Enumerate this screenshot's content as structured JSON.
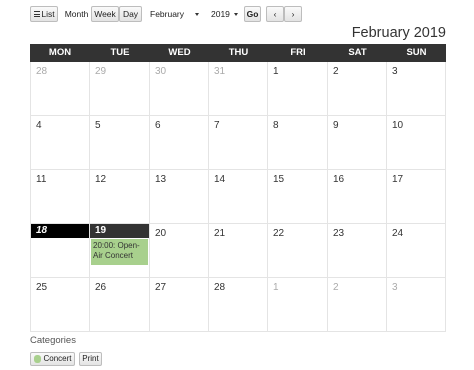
{
  "toolbar": {
    "list_label": "List",
    "month_label": "Month",
    "week_label": "Week",
    "day_label": "Day",
    "month_select": "February",
    "year_select": "2019",
    "go_label": "Go",
    "prev_label": "‹",
    "next_label": "›"
  },
  "title": "February 2019",
  "weekdays": [
    "MON",
    "TUE",
    "WED",
    "THU",
    "FRI",
    "SAT",
    "SUN"
  ],
  "weeks": [
    [
      {
        "day": "28",
        "other": true
      },
      {
        "day": "29",
        "other": true
      },
      {
        "day": "30",
        "other": true
      },
      {
        "day": "31",
        "other": true
      },
      {
        "day": "1"
      },
      {
        "day": "2"
      },
      {
        "day": "3"
      }
    ],
    [
      {
        "day": "4"
      },
      {
        "day": "5"
      },
      {
        "day": "6"
      },
      {
        "day": "7"
      },
      {
        "day": "8"
      },
      {
        "day": "9"
      },
      {
        "day": "10"
      }
    ],
    [
      {
        "day": "11"
      },
      {
        "day": "12"
      },
      {
        "day": "13"
      },
      {
        "day": "14"
      },
      {
        "day": "15"
      },
      {
        "day": "16"
      },
      {
        "day": "17"
      }
    ],
    [
      {
        "day": "18",
        "today": true
      },
      {
        "day": "19",
        "selected": true,
        "events": [
          "20:00: Open-Air Concert"
        ]
      },
      {
        "day": "20"
      },
      {
        "day": "21"
      },
      {
        "day": "22"
      },
      {
        "day": "23"
      },
      {
        "day": "24"
      }
    ],
    [
      {
        "day": "25"
      },
      {
        "day": "26"
      },
      {
        "day": "27"
      },
      {
        "day": "28"
      },
      {
        "day": "1",
        "other": true
      },
      {
        "day": "2",
        "other": true
      },
      {
        "day": "3",
        "other": true
      }
    ]
  ],
  "categories": {
    "label": "Categories",
    "items": [
      {
        "label": "Concert",
        "color": "#a8d08d"
      }
    ],
    "print_label": "Print"
  },
  "colors": {
    "header_bg": "#333333",
    "today_bg": "#000000",
    "event_bg": "#a8d08d"
  }
}
